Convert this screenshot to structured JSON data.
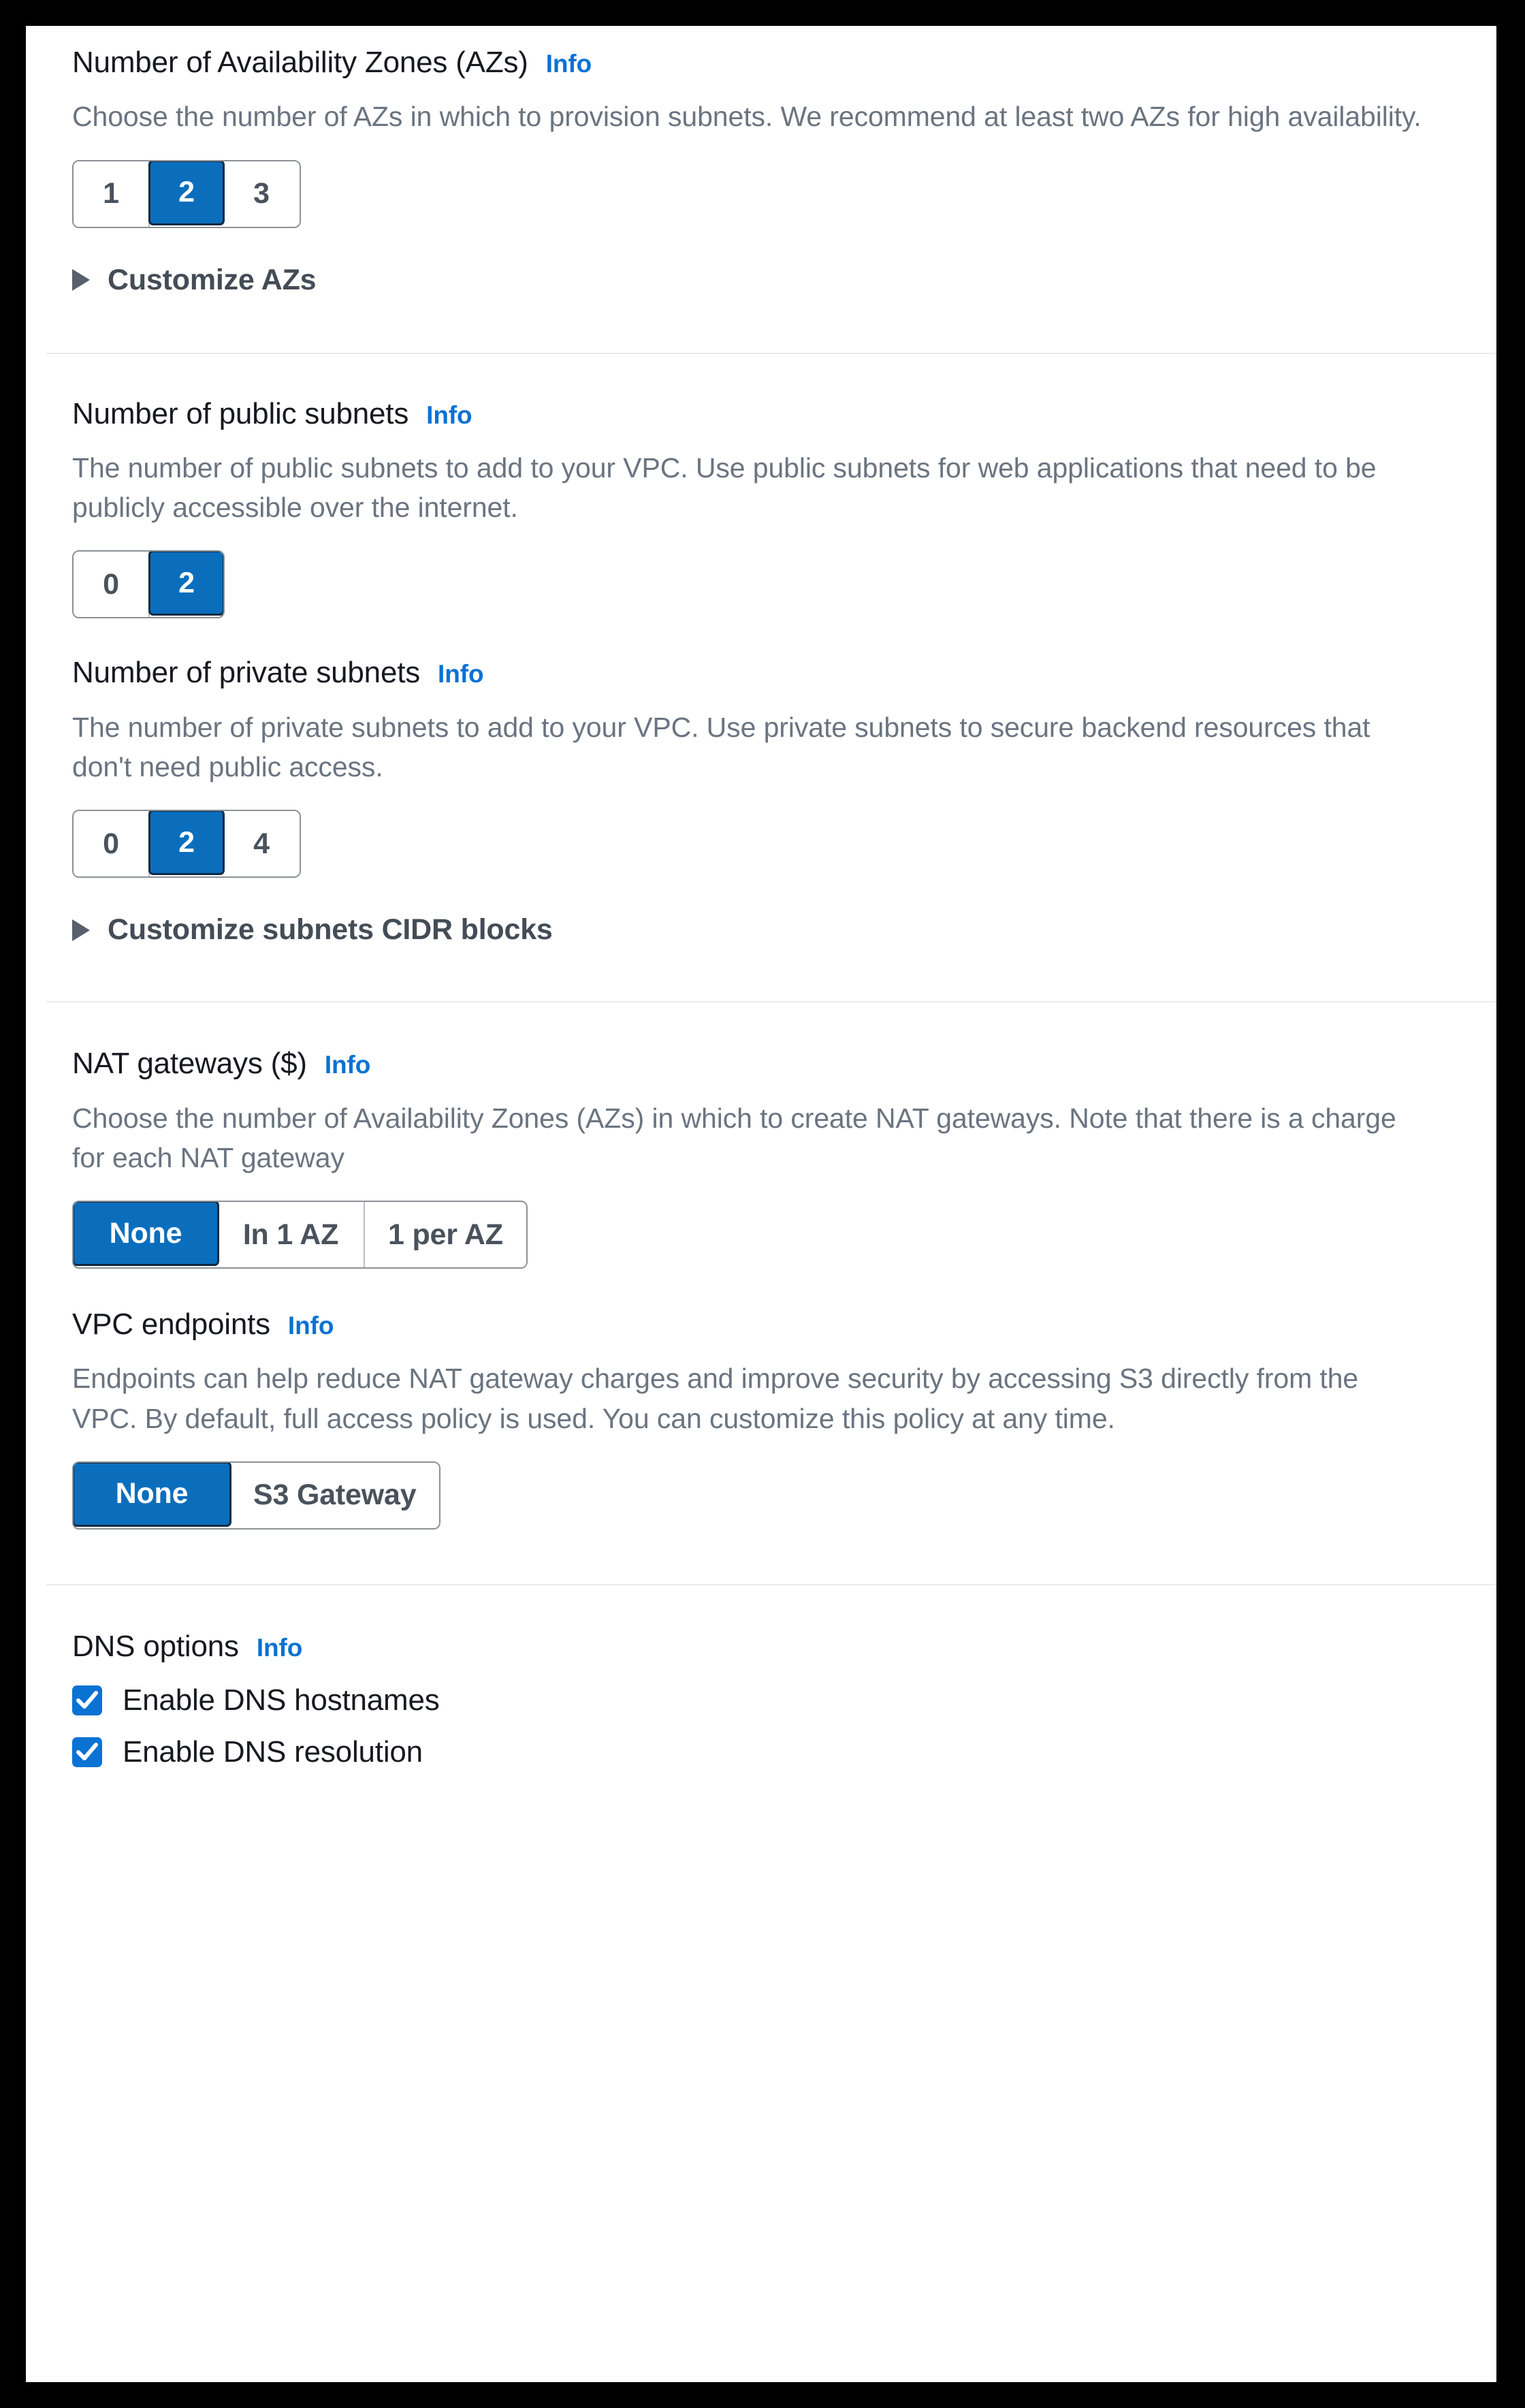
{
  "info_label": "Info",
  "colors": {
    "accent": "#0972d3",
    "selected_fill": "#0a6ebd",
    "selected_border": "#102a43",
    "label": "#16191f",
    "description": "#6b7480",
    "segment_border": "#8c9196",
    "divider": "#e9ebed",
    "frame": "#000000"
  },
  "sections": {
    "availability_zones": {
      "label": "Number of Availability Zones (AZs)",
      "description": "Choose the number of AZs in which to provision subnets. We recommend at least two AZs for high availability.",
      "options": [
        "1",
        "2",
        "3"
      ],
      "selected": "2",
      "expandable": {
        "label": "Customize AZs",
        "expanded": false,
        "icon": "caret-right-icon"
      }
    },
    "public_subnets": {
      "label": "Number of public subnets",
      "description": "The number of public subnets to add to your VPC. Use public subnets for web applications that need to be publicly accessible over the internet.",
      "options": [
        "0",
        "2"
      ],
      "selected": "2"
    },
    "private_subnets": {
      "label": "Number of private subnets",
      "description": "The number of private subnets to add to your VPC. Use private subnets to secure backend resources that don't need public access.",
      "options": [
        "0",
        "2",
        "4"
      ],
      "selected": "2",
      "expandable": {
        "label": "Customize subnets CIDR blocks",
        "expanded": false,
        "icon": "caret-right-icon"
      }
    },
    "nat_gateways": {
      "label": "NAT gateways ($)",
      "description": "Choose the number of Availability Zones (AZs) in which to create NAT gateways. Note that there is a charge for each NAT gateway",
      "options": [
        "None",
        "In 1 AZ",
        "1 per AZ"
      ],
      "selected": "None"
    },
    "vpc_endpoints": {
      "label": "VPC endpoints",
      "description": "Endpoints can help reduce NAT gateway charges and improve security by accessing S3 directly from the VPC. By default, full access policy is used. You can customize this policy at any time.",
      "options": [
        "None",
        "S3 Gateway"
      ],
      "selected": "None"
    },
    "dns_options": {
      "label": "DNS options",
      "checkboxes": [
        {
          "label": "Enable DNS hostnames",
          "checked": true
        },
        {
          "label": "Enable DNS resolution",
          "checked": true
        }
      ]
    }
  }
}
